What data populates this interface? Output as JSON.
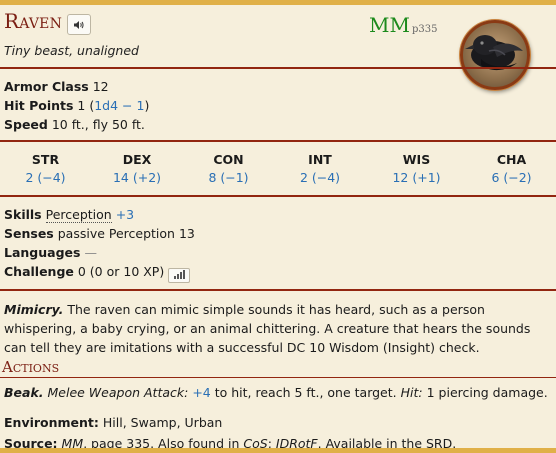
{
  "creature": {
    "name": "Raven",
    "subtitle": "Tiny beast, unaligned",
    "source_abbr": "MM",
    "source_page": "p335"
  },
  "core": {
    "ac_label": "Armor Class",
    "ac_value": "12",
    "hp_label": "Hit Points",
    "hp_value": "1",
    "hp_open": "(",
    "hp_formula": "1d4 − 1",
    "hp_close": ")",
    "speed_label": "Speed",
    "speed_value": "10 ft., fly 50 ft."
  },
  "abilities": [
    {
      "label": "STR",
      "value": "2 (−4)"
    },
    {
      "label": "DEX",
      "value": "14 (+2)"
    },
    {
      "label": "CON",
      "value": "8 (−1)"
    },
    {
      "label": "INT",
      "value": "2 (−4)"
    },
    {
      "label": "WIS",
      "value": "12 (+1)"
    },
    {
      "label": "CHA",
      "value": "6 (−2)"
    }
  ],
  "details": {
    "skills_label": "Skills",
    "skills_name": "Perception",
    "skills_bonus": "+3",
    "senses_label": "Senses",
    "senses_value": "passive Perception 13",
    "languages_label": "Languages",
    "languages_value": "—",
    "challenge_label": "Challenge",
    "challenge_value": "0 (0 or 10 XP)"
  },
  "traits": {
    "mimicry_name": "Mimicry.",
    "mimicry_text": "The raven can mimic simple sounds it has heard, such as a person whispering, a baby crying, or an animal chittering. A creature that hears the sounds can tell they are imitations with a successful DC 10 Wisdom (Insight) check."
  },
  "actions": {
    "title": "Actions",
    "beak_name": "Beak.",
    "beak_type": "Melee Weapon Attack:",
    "beak_bonus": "+4",
    "beak_text1": "to hit, reach 5 ft., one target.",
    "beak_hit": "Hit:",
    "beak_text2": "1 piercing damage."
  },
  "footer": {
    "env_label": "Environment:",
    "env_value": "Hill, Swamp, Urban",
    "source_label": "Source:",
    "source_book": "MM",
    "source_page_text": ", page 335. Also found in ",
    "source_other1": "CoS",
    "source_sep": "; ",
    "source_other2": "IDRotF",
    "source_tail": ". Available in the SRD."
  },
  "icons": {
    "sound": "speaker-icon",
    "xp": "bar-chart-icon"
  },
  "colors": {
    "name": "#7a1e12",
    "rule": "#922610",
    "link": "#2a6fb5",
    "source": "#1c8a1c",
    "border": "#e0b048"
  }
}
